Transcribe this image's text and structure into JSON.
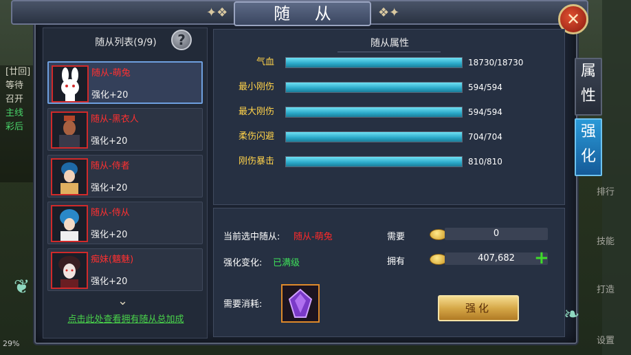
{
  "window": {
    "title": "随 从",
    "close_label": "✕"
  },
  "background": {
    "left_lines": [
      "[廿回]",
      "等待",
      "召开",
      "主线",
      "彩后"
    ],
    "percent": "29%",
    "right_labels": [
      "排行",
      "技能",
      "打造",
      "设置"
    ]
  },
  "list": {
    "title": "随从列表(9/9)",
    "help_label": "?",
    "items": [
      {
        "name": "随从-萌兔",
        "level": "强化+20",
        "selected": true,
        "icon": "rabbit-avatar-icon"
      },
      {
        "name": "随从-黑衣人",
        "level": "强化+20",
        "selected": false,
        "icon": "man-in-black-avatar-icon"
      },
      {
        "name": "随从-侍者",
        "level": "强化+20",
        "selected": false,
        "icon": "attendant-avatar-icon"
      },
      {
        "name": "随从-侍从",
        "level": "强化+20",
        "selected": false,
        "icon": "follower-avatar-icon"
      },
      {
        "name": "痴妹(魑魅)",
        "level": "强化+20",
        "selected": false,
        "icon": "ghost-girl-avatar-icon"
      }
    ],
    "footer_link": "点击此处查看拥有随从总加成"
  },
  "attributes": {
    "title": "随从属性",
    "rows": [
      {
        "label": "气血",
        "value": "18730/18730",
        "fill": 1.0
      },
      {
        "label": "最小刚伤",
        "value": "594/594",
        "fill": 1.0
      },
      {
        "label": "最大刚伤",
        "value": "594/594",
        "fill": 1.0
      },
      {
        "label": "柔伤闪避",
        "value": "704/704",
        "fill": 1.0
      },
      {
        "label": "刚伤暴击",
        "value": "810/810",
        "fill": 1.0
      }
    ]
  },
  "enhance": {
    "selected_label": "当前选中随从:",
    "selected_name": "随从-萌兔",
    "change_label": "强化变化:",
    "change_value": "已满级",
    "need_label": "需要",
    "need_value": "0",
    "own_label": "拥有",
    "own_value": "407,682",
    "plus_label": "+",
    "consume_label": "需要消耗:",
    "button_label": "强化"
  },
  "tabs": {
    "attr_chars": [
      "属",
      "性"
    ],
    "enhance_chars": [
      "强",
      "化"
    ]
  },
  "colors": {
    "accent_red": "#ff2a2a",
    "accent_green": "#3ee05a",
    "accent_gold": "#ffd24a",
    "bar_cyan": "#2aa8c8",
    "tab_blue": "#2a9ad8"
  }
}
